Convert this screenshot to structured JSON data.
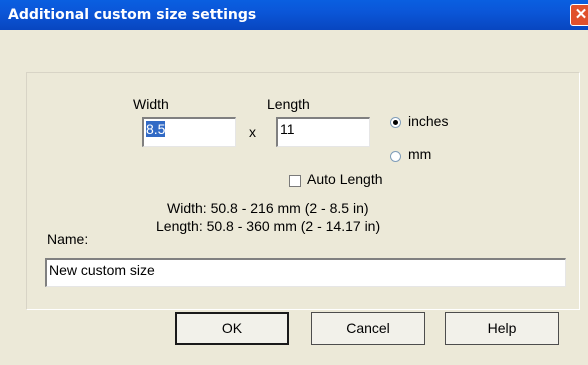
{
  "window": {
    "title": "Additional custom size settings",
    "close_glyph": "✕"
  },
  "size": {
    "width_label": "Width",
    "width_value": "8.5",
    "times_label": "x",
    "length_label": "Length",
    "length_value": "11"
  },
  "units": {
    "inches_label": "inches",
    "inches_selected": true,
    "mm_label": "mm",
    "mm_selected": false
  },
  "auto_length": {
    "label": "Auto Length",
    "checked": false
  },
  "limits": {
    "width_range": "Width: 50.8 - 216 mm  (2 - 8.5 in)",
    "length_range": "Length: 50.8 - 360 mm  (2 - 14.17 in)"
  },
  "name": {
    "label": "Name:",
    "value": "New custom size"
  },
  "buttons": {
    "ok": "OK",
    "cancel": "Cancel",
    "help": "Help"
  }
}
